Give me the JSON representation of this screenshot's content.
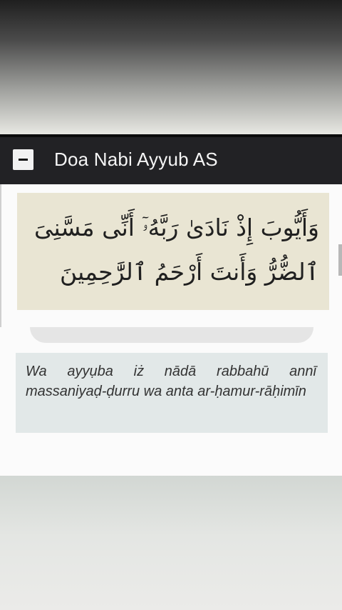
{
  "header": {
    "title": "Doa Nabi Ayyub AS",
    "toggle_icon": "minus-icon"
  },
  "prayer": {
    "arabic": "وَأَيُّوبَ إِذْ نَادَىٰ رَبَّهُۥٓ أَنِّى مَسَّنِىَ ٱلضُّرُّ وَأَنتَ أَرْحَمُ ٱلرَّٰحِمِينَ",
    "transliteration": "Wa ayyụba iż nādā rabbahū annī massaniyaḍ-ḍurru wa anta ar-ḥamur-rāḥimīn"
  },
  "colors": {
    "header_bg": "#222225",
    "arabic_box_bg": "#e9e5d3",
    "translit_box_bg": "#e2e8e8"
  }
}
